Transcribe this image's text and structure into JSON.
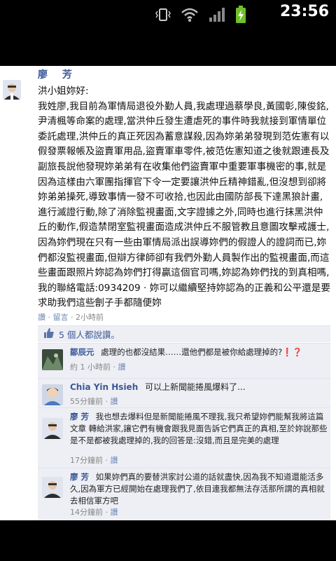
{
  "status_bar": {
    "time": "23:56",
    "icons": [
      "vibrate-icon",
      "wifi-icon",
      "signal-icon",
      "battery-charging-icon"
    ]
  },
  "post": {
    "author": "廖 芳",
    "greeting": "洪小姐妳好:",
    "body": "我姓廖,我目前為軍情局退役外勤人員,我處理過蔡學良,黃國彰,陳俊銘,尹清楓等命案的處理,當洪仲丘發生遭虐死的事件時我就接到軍情單位委託處理,洪仲丘的真正死因為蓄意謀殺,因為妳弟弟發現到范佐憲有以假發票報帳及盜賣軍用品,盜賣軍車零件,被范佐憲知道之後就跟連長及副旅長說他發現妳弟弟有在收集他們盜賣軍中重要軍事機密的事,就是因為這樣由六軍團指揮官下令一定要讓洪仲丘精神錯亂,但沒想到卻將妳弟弟操死,導致事情一發不可收拾,也因此由國防部長下達黑狼計畫,進行滅證行動,除了消除監視畫面,文字證據之外,同時也進行抹黑洪仲丘的動作,假造禁閉室監視畫面造成洪仲丘不服管教且意圖攻擊戒護士,因為妳們現在只有一些由軍情局派出誤導妳們的假證人的證詞而已,妳們都沒監視畫面,但辯方律師卻有我們外勤人員製作出的監視畫面,而這些畫面跟照片妳認為妳們打得贏這個官司嗎,妳認為妳們找的到真相嗎,我的聯絡電話:0934209 · 妳可以繼續堅持妳認為的正義和公平還是要求助我們這些劊子手都隨便妳",
    "meta_like": "讚",
    "meta_comment": "留言",
    "meta_time": "2小時前"
  },
  "likes": {
    "text": "5 個人都說讚。"
  },
  "comments": [
    {
      "author": "鄒辰元",
      "text": "處理的也都沒結果……還他們都是被你給處理掉的?❗❓",
      "time": "約 1 小時前",
      "like": "讚"
    },
    {
      "author": "Chia Yin Hsieh",
      "text": "可以上新聞能捲風爆料了...",
      "time": "55分鐘前",
      "like": "讚"
    },
    {
      "author": "廖 芳",
      "text": "我也想去爆料但是新聞能捲風不理我,我只希望妳們能幫我將這篇文章 轉給洪家,讓它們有機會跟我見面告訴它們真正的真相,至於妳說那些是不是都被我處理掉的,我的回答是:沒錯,而且是完美的處理",
      "time": "17分鐘前",
      "like": "讚"
    },
    {
      "author": "廖 芳",
      "text": "如果妳們真的要替洪家討公道的話就盡快,因為我不知道還能活多久,因為軍方已經開始在處理我們了,依目連我都無法存活那所謂的真相就去相信軍方吧",
      "time": "14分鐘前",
      "like": "讚"
    }
  ],
  "colors": {
    "link_blue": "#3b5998",
    "comment_bg": "#edeff4",
    "like_icon": "#5b74a8"
  }
}
